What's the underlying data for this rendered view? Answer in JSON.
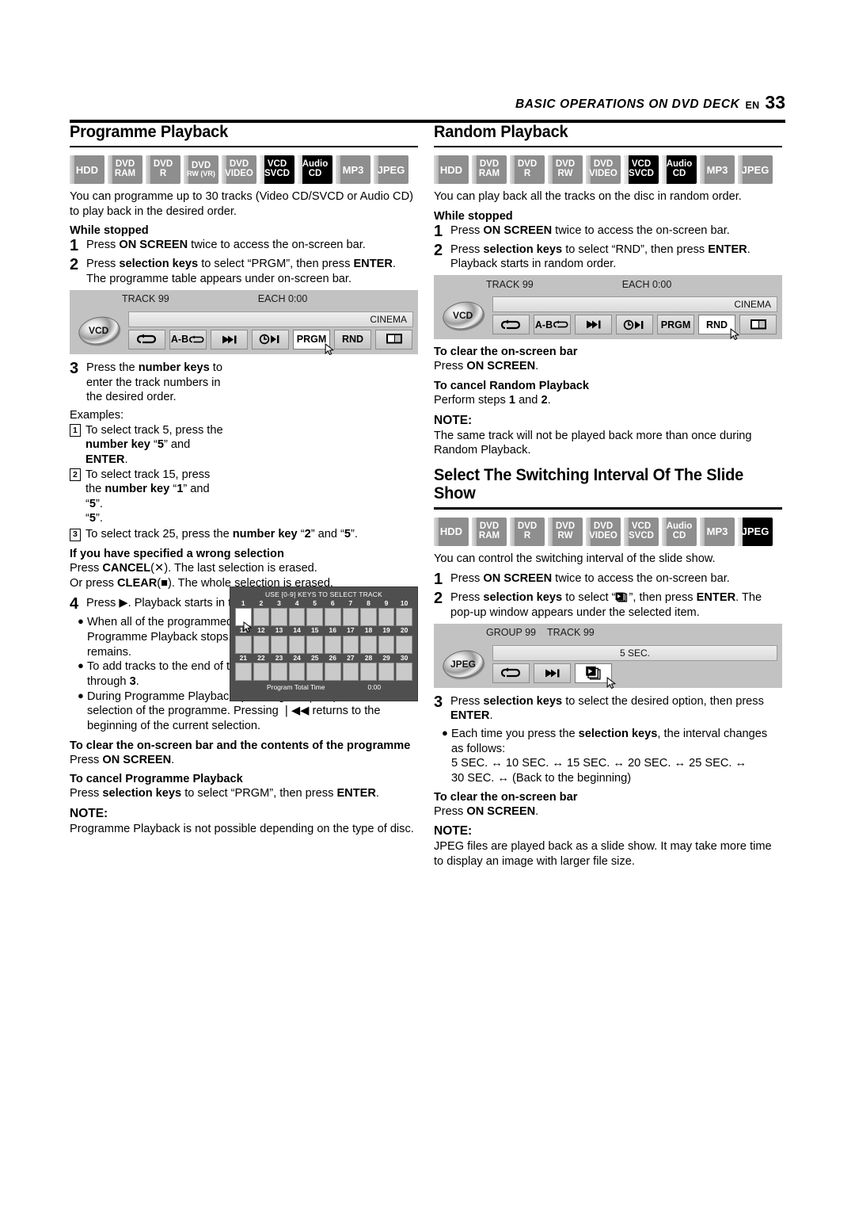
{
  "header": {
    "title": "BASIC OPERATIONS ON DVD DECK",
    "en": "EN",
    "page": "33"
  },
  "disc_badges": {
    "set1": [
      {
        "l1": "HDD",
        "l2": "",
        "state": "grey"
      },
      {
        "l1": "DVD",
        "l2": "RAM",
        "state": "grey"
      },
      {
        "l1": "DVD",
        "l2": "R",
        "state": "grey"
      },
      {
        "l1": "DVD",
        "l2": "RW (VR)",
        "state": "grey"
      },
      {
        "l1": "DVD",
        "l2": "VIDEO",
        "state": "grey"
      },
      {
        "l1": "VCD",
        "l2": "SVCD",
        "state": "black"
      },
      {
        "l1": "Audio",
        "l2": "CD",
        "state": "black"
      },
      {
        "l1": "MP3",
        "l2": "",
        "state": "grey"
      },
      {
        "l1": "JPEG",
        "l2": "",
        "state": "grey"
      }
    ],
    "set2": [
      {
        "l1": "HDD",
        "l2": "",
        "state": "grey"
      },
      {
        "l1": "DVD",
        "l2": "RAM",
        "state": "grey"
      },
      {
        "l1": "DVD",
        "l2": "R",
        "state": "grey"
      },
      {
        "l1": "DVD",
        "l2": "RW",
        "state": "grey"
      },
      {
        "l1": "DVD",
        "l2": "VIDEO",
        "state": "grey"
      },
      {
        "l1": "VCD",
        "l2": "SVCD",
        "state": "black"
      },
      {
        "l1": "Audio",
        "l2": "CD",
        "state": "black"
      },
      {
        "l1": "MP3",
        "l2": "",
        "state": "grey"
      },
      {
        "l1": "JPEG",
        "l2": "",
        "state": "grey"
      }
    ],
    "set3": [
      {
        "l1": "HDD",
        "l2": "",
        "state": "grey"
      },
      {
        "l1": "DVD",
        "l2": "RAM",
        "state": "grey"
      },
      {
        "l1": "DVD",
        "l2": "R",
        "state": "grey"
      },
      {
        "l1": "DVD",
        "l2": "RW",
        "state": "grey"
      },
      {
        "l1": "DVD",
        "l2": "VIDEO",
        "state": "grey"
      },
      {
        "l1": "VCD",
        "l2": "SVCD",
        "state": "grey"
      },
      {
        "l1": "Audio",
        "l2": "CD",
        "state": "grey"
      },
      {
        "l1": "MP3",
        "l2": "",
        "state": "grey"
      },
      {
        "l1": "JPEG",
        "l2": "",
        "state": "black"
      }
    ]
  },
  "programme": {
    "title": "Programme Playback",
    "intro": "You can programme up to 30 tracks (Video CD/SVCD or Audio CD) to play back in the desired order.",
    "while_stopped": "While stopped",
    "step1_num": "1",
    "step1": "Press ON SCREEN twice to access the on-screen bar.",
    "step2_num": "2",
    "step2": "Press selection keys to select “PRGM”, then press ENTER. The programme table appears under on-screen bar.",
    "step3_num": "3",
    "step3": "Press the number keys to enter the track numbers in the desired order.",
    "examples_label": "Examples:",
    "ex1_num": "1",
    "ex1": "To select track 5, press the number key “5” and ENTER.",
    "ex2_num": "2",
    "ex2": "To select track 15, press the number key “1” and “5”.",
    "ex3_num": "3",
    "ex3": "To select track 25, press the number key “2” and “5”.",
    "wrong_heading": "If you have specified a wrong selection",
    "wrong_line1": "Press CANCEL(✕). The last selection is erased.",
    "wrong_line2": "Or press CLEAR(■). The whole selection is erased.",
    "step4_num": "4",
    "step4": "Press ▶. Playback starts in the programmed order.",
    "bullet1": "When all of the programmed tracks have been played back, Programme Playback stops, but the programmed information remains.",
    "bullet2": "To add tracks to the end of the programme, perform steps 1 through 3.",
    "bullet3": "During Programme Playback, pressing ▶▶❘ skips to the next selection of the programme. Pressing ❘◀◀ returns to the beginning of the current selection.",
    "clear_heading": "To clear the on-screen bar and the contents of the programme",
    "clear_line": "Press ON SCREEN.",
    "cancel_heading": "To cancel Programme Playback",
    "cancel_line": "Press selection keys to select “PRGM”, then press ENTER.",
    "note_label": "NOTE:",
    "note_text": "Programme Playback is not possible depending on the type of disc."
  },
  "osd_left": {
    "disc_label": "VCD",
    "track": "TRACK 99",
    "each": "EACH 0:00",
    "cinema": "CINEMA",
    "keys": [
      {
        "label": "repeat-icon",
        "selected": false
      },
      {
        "label": "A-B",
        "selected": false
      },
      {
        "label": "skip-icon",
        "selected": false
      },
      {
        "label": "time-skip-icon",
        "selected": false
      },
      {
        "label": "PRGM",
        "selected": true
      },
      {
        "label": "RND",
        "selected": false
      },
      {
        "label": "screen-icon",
        "selected": false
      }
    ]
  },
  "prg_table": {
    "header": "USE [0-9] KEYS TO SELECT TRACK",
    "row1": [
      "1",
      "2",
      "3",
      "4",
      "5",
      "6",
      "7",
      "8",
      "9",
      "10"
    ],
    "row2": [
      "11",
      "12",
      "13",
      "14",
      "15",
      "16",
      "17",
      "18",
      "19",
      "20"
    ],
    "row3": [
      "21",
      "22",
      "23",
      "24",
      "25",
      "26",
      "27",
      "28",
      "29",
      "30"
    ],
    "total_label": "Program Total Time",
    "total_value": "0:00"
  },
  "random": {
    "title": "Random Playback",
    "intro": "You can play back all the tracks on the disc in random order.",
    "while_stopped": "While stopped",
    "step1_num": "1",
    "step1": "Press ON SCREEN twice to access the on-screen bar.",
    "step2_num": "2",
    "step2": "Press selection keys to select “RND”, then press ENTER. Playback starts in random order.",
    "clear_heading": "To clear the on-screen bar",
    "clear_line": "Press ON SCREEN.",
    "cancel_heading": "To cancel Random Playback",
    "cancel_line": "Perform steps 1 and 2.",
    "note_label": "NOTE:",
    "note_text": "The same track will not be played back more than once during Random Playback."
  },
  "osd_right": {
    "disc_label": "VCD",
    "track": "TRACK 99",
    "each": "EACH 0:00",
    "cinema": "CINEMA",
    "keys": [
      {
        "label": "repeat-icon",
        "selected": false
      },
      {
        "label": "A-B",
        "selected": false
      },
      {
        "label": "skip-icon",
        "selected": false
      },
      {
        "label": "time-skip-icon",
        "selected": false
      },
      {
        "label": "PRGM",
        "selected": false
      },
      {
        "label": "RND",
        "selected": true
      },
      {
        "label": "screen-icon",
        "selected": false
      }
    ]
  },
  "slideshow": {
    "title": "Select The Switching Interval Of The Slide Show",
    "intro": "You can control the switching interval of the slide show.",
    "step1_num": "1",
    "step1": "Press ON SCREEN twice to access the on-screen bar.",
    "step2_num": "2",
    "step2_a": "Press selection keys to select “",
    "step2_b": "”, then press ENTER. The pop-up window appears under the selected item.",
    "step3_num": "3",
    "step3": "Press selection keys to select the desired option, then press ENTER.",
    "bullet1": "Each time you press the selection keys, the interval changes as follows:",
    "intervals_line1": "5 SEC. ↔ 10 SEC. ↔ 15 SEC. ↔ 20 SEC. ↔ 25 SEC. ↔",
    "intervals_line2": "30 SEC. ↔ (Back to the beginning)",
    "clear_heading": "To clear the on-screen bar",
    "clear_line": "Press ON SCREEN.",
    "note_label": "NOTE:",
    "note_text": "JPEG files are played back as a slide show. It may take more time to display an image with larger file size."
  },
  "osd_slide": {
    "disc_label": "JPEG",
    "group": "GROUP 99",
    "track": "TRACK 99",
    "interval": "5 SEC.",
    "keys": [
      {
        "label": "repeat-icon",
        "selected": false
      },
      {
        "label": "skip-icon",
        "selected": false
      },
      {
        "label": "slideshow-icon",
        "selected": true
      }
    ]
  },
  "colors": {
    "badge_inactive": "#8e8e8e",
    "badge_active": "#000000",
    "osd_panel": "#c2c2c2",
    "table_bg": "#4f4f4f",
    "cell": "#c9c9c9"
  }
}
